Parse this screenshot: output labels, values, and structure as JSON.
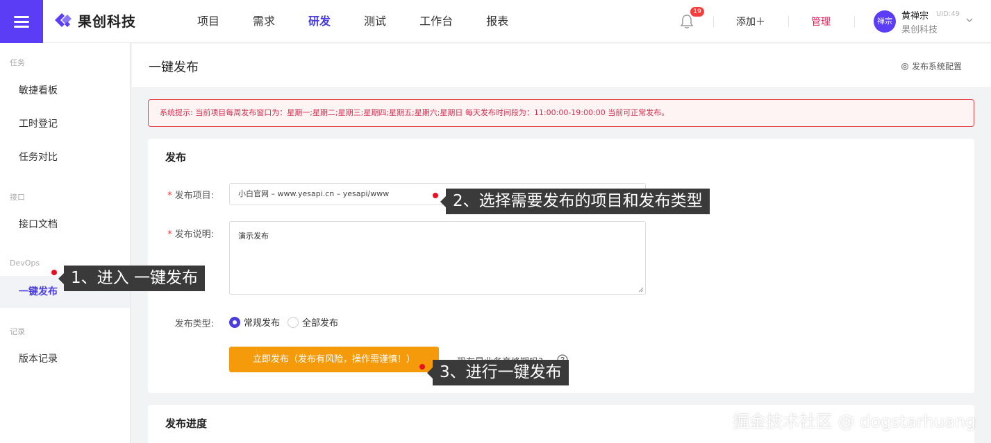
{
  "app": {
    "brand": "果创科技"
  },
  "nav": {
    "items": [
      "项目",
      "需求",
      "研发",
      "测试",
      "工作台",
      "报表"
    ],
    "active_index": 2
  },
  "header_right": {
    "notification_count": "19",
    "add_label": "添加＋",
    "manage_label": "管理",
    "avatar_text": "禅宗",
    "user_name": "黄禅宗",
    "user_uid": "UID:49",
    "user_org": "果创科技"
  },
  "sidebar": {
    "groups": {
      "task": "任务",
      "api": "接口",
      "devops": "DevOps",
      "record": "记录"
    },
    "items": {
      "kanban": "敏捷看板",
      "worklog": "工时登记",
      "compare": "任务对比",
      "apidoc": "接口文档",
      "deploy": "一键发布",
      "version": "版本记录"
    },
    "active": "deploy"
  },
  "page": {
    "title": "一键发布",
    "config_link": "发布系统配置",
    "alert": "系统提示: 当前项目每周发布窗口为：星期一;星期二;星期三;星期四;星期五;星期六;星期日 每天发布时间段为：11:00:00-19:00:00 当前可正常发布。"
  },
  "form": {
    "section_title": "发布",
    "project_label": "发布项目:",
    "project_value": "小白官网 – www.yesapi.cn – yesapi/www",
    "desc_label": "发布说明:",
    "desc_value": "演示发布",
    "type_label": "发布类型:",
    "type_options": [
      "常规发布",
      "全部发布"
    ],
    "type_selected": "常规发布",
    "publish_button": "立即发布（发布有风险，操作需谨慎！）",
    "peak_question": "现在是业务高峰期吗?"
  },
  "progress": {
    "section_title": "发布进度"
  },
  "annotations": {
    "step1": "1、进入 一键发布",
    "step2": "2、选择需要发布的项目和发布类型",
    "step3": "3、进行一键发布"
  },
  "watermark": "掘金技术社区 @ dogstarhuang",
  "colors": {
    "brand": "#5b3df5",
    "active_nav": "#4a3de0",
    "alert": "#d03050",
    "publish_button": "#f59a0b",
    "manage": "#e0245e"
  }
}
